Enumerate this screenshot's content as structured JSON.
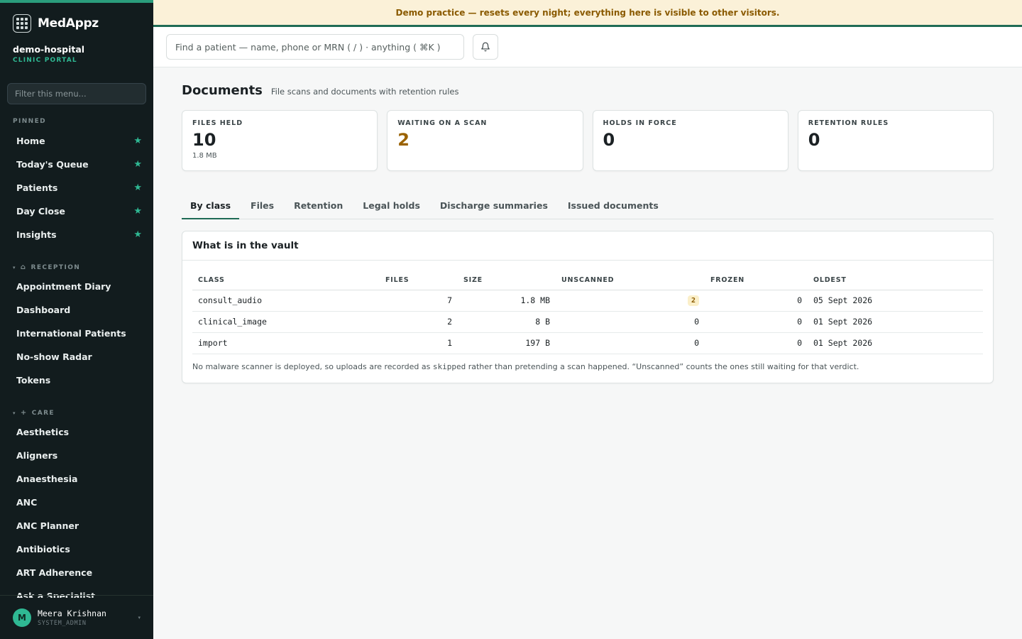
{
  "banner": "Demo practice — resets every night; everything here is visible to other visitors.",
  "sidebar": {
    "brand": "MedAppz",
    "org_name": "demo-hospital",
    "org_sub": "CLINIC PORTAL",
    "filter_placeholder": "Filter this menu...",
    "pinned_label": "PINNED",
    "pinned": [
      "Home",
      "Today's Queue",
      "Patients",
      "Day Close",
      "Insights"
    ],
    "reception_label": "RECEPTION",
    "reception": [
      "Appointment Diary",
      "Dashboard",
      "International Patients",
      "No-show Radar",
      "Tokens"
    ],
    "care_label": "CARE",
    "care": [
      "Aesthetics",
      "Aligners",
      "Anaesthesia",
      "ANC",
      "ANC Planner",
      "Antibiotics",
      "ART Adherence",
      "Ask a Specialist"
    ],
    "user": {
      "initial": "M",
      "name": "Meera Krishnan",
      "role": "SYSTEM_ADMIN"
    }
  },
  "topbar": {
    "search_placeholder": "Find a patient — name, phone or MRN ( / ) · anything ( ⌘K )"
  },
  "page": {
    "title": "Documents",
    "subtitle": "File scans and documents with retention rules"
  },
  "stats": [
    {
      "label": "FILES HELD",
      "value": "10",
      "note": "1.8 MB"
    },
    {
      "label": "WAITING ON A SCAN",
      "value": "2",
      "note": ""
    },
    {
      "label": "HOLDS IN FORCE",
      "value": "0",
      "note": ""
    },
    {
      "label": "RETENTION RULES",
      "value": "0",
      "note": ""
    }
  ],
  "tabs": [
    "By class",
    "Files",
    "Retention",
    "Legal holds",
    "Discharge summaries",
    "Issued documents"
  ],
  "vault": {
    "title": "What is in the vault",
    "columns": [
      "CLASS",
      "FILES",
      "SIZE",
      "UNSCANNED",
      "FROZEN",
      "OLDEST"
    ],
    "rows": [
      {
        "class": "consult_audio",
        "files": "7",
        "size": "1.8 MB",
        "unscanned": "2",
        "frozen": "0",
        "oldest": "05 Sept 2026"
      },
      {
        "class": "clinical_image",
        "files": "2",
        "size": "8 B",
        "unscanned": "0",
        "frozen": "0",
        "oldest": "01 Sept 2026"
      },
      {
        "class": "import",
        "files": "1",
        "size": "197 B",
        "unscanned": "0",
        "frozen": "0",
        "oldest": "01 Sept 2026"
      }
    ],
    "footnote_pre": "No malware scanner is deployed, so uploads are recorded as ",
    "footnote_code": "skipped",
    "footnote_post": " rather than pretending a scan happened. “Unscanned” counts the ones still waiting for that verdict."
  },
  "colors": {
    "accent": "#1f6b55",
    "brand_green": "#2fb893",
    "warn": "#9a6200",
    "sidebar_bg": "#121c1e"
  }
}
